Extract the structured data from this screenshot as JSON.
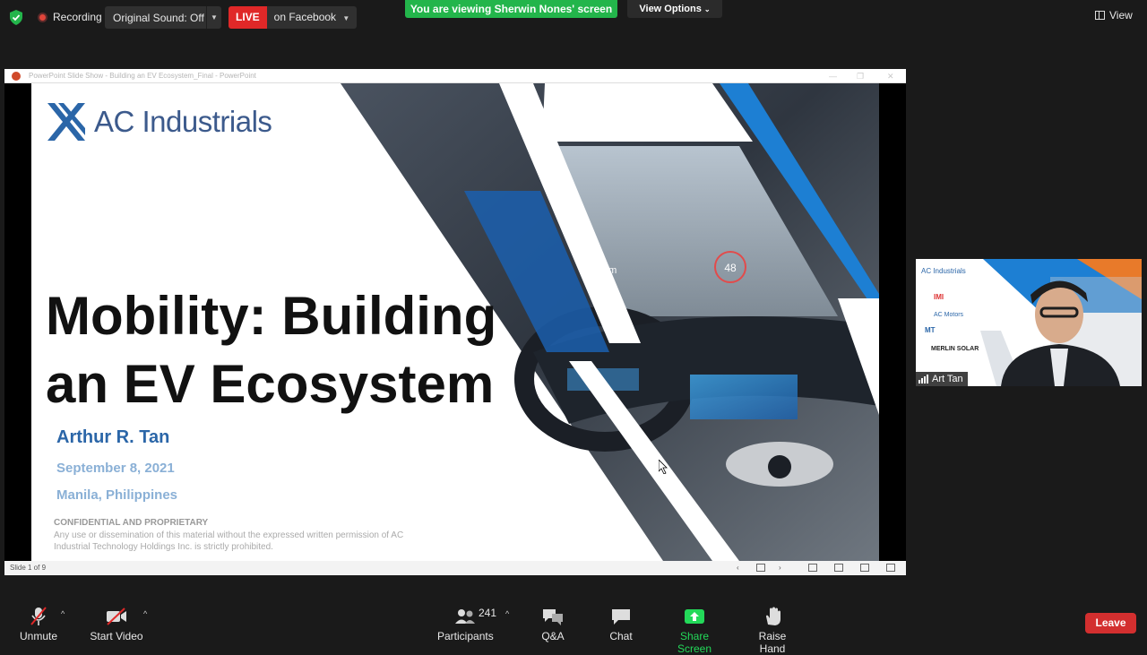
{
  "topbar": {
    "recording": "Recording",
    "original_sound": "Original Sound: Off",
    "live": "LIVE",
    "live_target": "on Facebook",
    "viewing_banner": "You are viewing Sherwin Nones' screen",
    "view_options": "View Options",
    "view": "View"
  },
  "share_window": {
    "title": "PowerPoint Slide Show - Building an EV Ecosystem_Final - PowerPoint",
    "slide_status": "Slide 1 of 9"
  },
  "slide": {
    "logo_text": "AC Industrials",
    "title_line1": "Mobility: Building",
    "title_line2": "an EV Ecosystem",
    "author": "Arthur R. Tan",
    "date": "September 8,  2021",
    "place": "Manila, Philippines",
    "confidential_heading": "CONFIDENTIAL AND PROPRIETARY",
    "confidential_body": "Any use or dissemination of this material without the expressed written permission of AC Industrial Technology Holdings Inc. is strictly prohibited.",
    "hud_speed": "48",
    "hud_distance": "0m"
  },
  "video": {
    "participant_name": "Art Tan",
    "logos": [
      "AC Industrials",
      "IMI",
      "AC Motors",
      "MT",
      "MERLIN SOLAR"
    ]
  },
  "toolbar": {
    "unmute": "Unmute",
    "start_video": "Start Video",
    "participants": "Participants",
    "participant_count": "241",
    "qa": "Q&A",
    "chat": "Chat",
    "share_screen": "Share Screen",
    "raise_hand": "Raise Hand",
    "leave": "Leave"
  },
  "colors": {
    "viewing_green": "#23b54b",
    "live_red": "#e02828",
    "leave_red": "#d32f2f",
    "brand_blue": "#2b66a8",
    "share_green": "#23d959"
  },
  "icons": [
    "shield-icon",
    "record-icon",
    "mic-muted-icon",
    "video-off-icon",
    "participants-icon",
    "qa-icon",
    "chat-icon",
    "share-screen-icon",
    "raise-hand-icon",
    "grid-view-icon"
  ]
}
